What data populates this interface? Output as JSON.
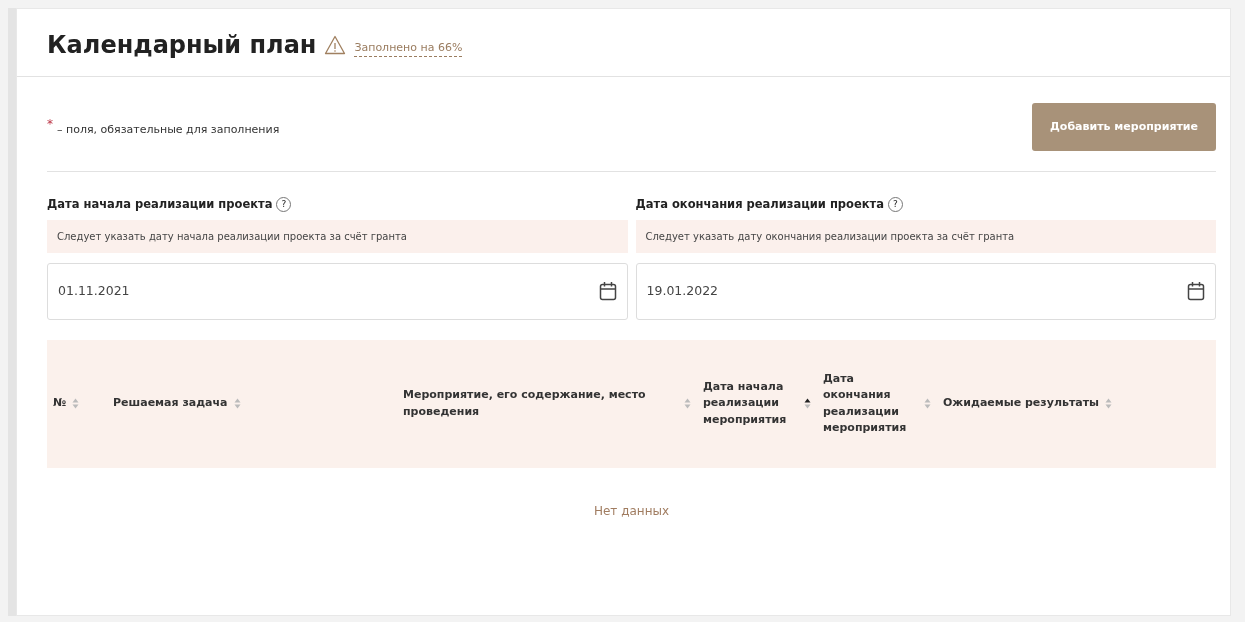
{
  "title": "Календарный план",
  "completion": {
    "warning": true,
    "text": "Заполнено на 66%"
  },
  "required_note": {
    "mark": "*",
    "text": "– поля, обязательные для заполнения"
  },
  "add_button": "Добавить мероприятие",
  "date_fields": [
    {
      "label": "Дата начала реализации проекта",
      "help": "?",
      "hint": "Следует указать дату начала реализации проекта за счёт гранта",
      "value": "01.11.2021"
    },
    {
      "label": "Дата окончания реализации проекта",
      "help": "?",
      "hint": "Следует указать дату окончания реализации проекта за счёт гранта",
      "value": "19.01.2022"
    }
  ],
  "table": {
    "columns": [
      {
        "label": "№",
        "sorted": false
      },
      {
        "label": "Решаемая задача",
        "sorted": false
      },
      {
        "label": "Мероприятие, его содержание, место проведения",
        "sorted": false
      },
      {
        "label": "Дата начала реализации мероприятия",
        "sorted": true
      },
      {
        "label": "Дата окончания реализации мероприятия",
        "sorted": false
      },
      {
        "label": "Ожидаемые результаты",
        "sorted": false
      }
    ],
    "empty_text": "Нет данных"
  }
}
